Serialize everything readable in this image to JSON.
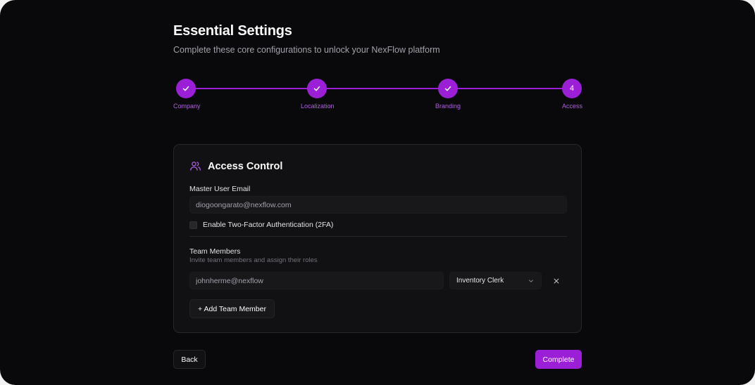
{
  "header": {
    "title": "Essential Settings",
    "subtitle": "Complete these core configurations to unlock your NexFlow platform"
  },
  "stepper": {
    "accent_color": "#9b1fd6",
    "steps": [
      {
        "label": "Company",
        "status": "complete",
        "icon": "check-icon"
      },
      {
        "label": "Localization",
        "status": "complete",
        "icon": "check-icon"
      },
      {
        "label": "Branding",
        "status": "complete",
        "icon": "check-icon"
      },
      {
        "label": "Access",
        "status": "current",
        "number": "4"
      }
    ]
  },
  "card": {
    "icon": "users-icon",
    "title": "Access Control",
    "master_email": {
      "label": "Master User Email",
      "value": "diogoongarato@nexflow.com"
    },
    "two_factor": {
      "label": "Enable Two-Factor Authentication (2FA)",
      "checked": false
    },
    "team": {
      "title": "Team Members",
      "subtitle": "Invite team members and assign their roles",
      "members": [
        {
          "email": "johnherme@nexflow",
          "role": "Inventory Clerk"
        }
      ],
      "add_label": "+ Add Team Member"
    }
  },
  "footer": {
    "back_label": "Back",
    "complete_label": "Complete"
  },
  "colors": {
    "background": "#09090b",
    "card": "#111113",
    "accent": "#9b1fd6"
  }
}
